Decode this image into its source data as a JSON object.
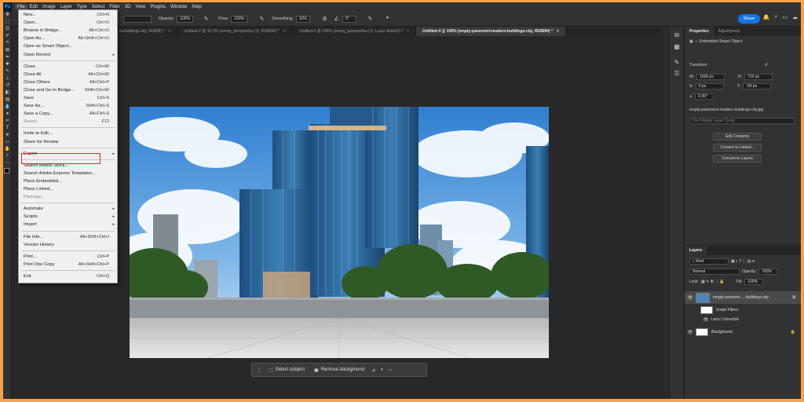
{
  "menubar": {
    "logo": "Ps",
    "items": [
      "File",
      "Edit",
      "Image",
      "Layer",
      "Type",
      "Select",
      "Filter",
      "3D",
      "View",
      "Plugins",
      "Window",
      "Help"
    ]
  },
  "options": {
    "opacity_label": "Opacity:",
    "opacity_value": "100%",
    "flow_label": "Flow:",
    "flow_value": "100%",
    "smoothing_label": "Smoothing:",
    "smoothing_value": "10%",
    "angle_value": "0°",
    "share_label": "Share"
  },
  "tabs": [
    {
      "label": "re-buildings-city, RGB/8) *",
      "active": false
    },
    {
      "label": "Untitled-2 @ 10.1% (wrong_perspective (1), RGB/8#) *",
      "active": false
    },
    {
      "label": "Untitled-3 @ 100% (wrong_perspective (1), Layer Mask/8) *",
      "active": false
    },
    {
      "label": "Untitled-4 @ 100% (empty-pavement-modern-buildings-city, RGB/8#) *",
      "active": true
    }
  ],
  "file_menu": {
    "items": [
      {
        "label": "New...",
        "shortcut": "Ctrl+N"
      },
      {
        "label": "Open...",
        "shortcut": "Ctrl+O"
      },
      {
        "label": "Browse in Bridge...",
        "shortcut": "Alt+Ctrl+O"
      },
      {
        "label": "Open As...",
        "shortcut": "Alt+Shift+Ctrl+O"
      },
      {
        "label": "Open as Smart Object...",
        "shortcut": ""
      },
      {
        "label": "Open Recent",
        "shortcut": "",
        "submenu": true
      },
      {
        "label": "Close",
        "shortcut": "Ctrl+W"
      },
      {
        "label": "Close All",
        "shortcut": "Alt+Ctrl+W"
      },
      {
        "label": "Close Others",
        "shortcut": "Alt+Ctrl+P"
      },
      {
        "label": "Close and Go to Bridge...",
        "shortcut": "Shift+Ctrl+W"
      },
      {
        "label": "Save",
        "shortcut": "Ctrl+S"
      },
      {
        "label": "Save As...",
        "shortcut": "Shift+Ctrl+S"
      },
      {
        "label": "Save a Copy...",
        "shortcut": "Alt+Ctrl+S"
      },
      {
        "label": "Revert",
        "shortcut": "F12",
        "disabled": true
      },
      {
        "label": "Invite to Edit...",
        "shortcut": ""
      },
      {
        "label": "Share for Review",
        "shortcut": ""
      },
      {
        "label": "Export",
        "shortcut": "",
        "submenu": true
      },
      {
        "label": "Search Adobe Stock...",
        "shortcut": ""
      },
      {
        "label": "Search Adobe Express Templates...",
        "shortcut": ""
      },
      {
        "label": "Place Embedded...",
        "shortcut": ""
      },
      {
        "label": "Place Linked...",
        "shortcut": ""
      },
      {
        "label": "Package...",
        "shortcut": "",
        "disabled": true
      },
      {
        "label": "Automate",
        "shortcut": "",
        "submenu": true
      },
      {
        "label": "Scripts",
        "shortcut": "",
        "submenu": true
      },
      {
        "label": "Import",
        "shortcut": "",
        "submenu": true
      },
      {
        "label": "File Info...",
        "shortcut": "Alt+Shift+Ctrl+I"
      },
      {
        "label": "Version History",
        "shortcut": ""
      },
      {
        "label": "Print...",
        "shortcut": "Ctrl+P"
      },
      {
        "label": "Print One Copy",
        "shortcut": "Alt+Shift+Ctrl+P"
      },
      {
        "label": "Exit",
        "shortcut": "Ctrl+Q"
      }
    ]
  },
  "floatbar": {
    "select_subject": "Select subject",
    "remove_background": "Remove background"
  },
  "properties": {
    "tab_properties": "Properties",
    "tab_adjustments": "Adjustments",
    "object_type": "Embedded Smart Object",
    "transform_label": "Transform",
    "w_label": "W:",
    "w_value": "1000 px",
    "h_label": "H:",
    "h_value": "710 px",
    "x_label": "X:",
    "x_value": "0 px",
    "y_label": "Y:",
    "y_value": "-59 px",
    "angle_value": "0.00°",
    "file_name": "empty-pavement-modern-buildings-city.jpg",
    "layer_comp_placeholder": "Don't Apply Layer Comp",
    "edit_contents": "Edit Contents",
    "convert_linked": "Convert to Linked...",
    "convert_layers": "Convert to Layers"
  },
  "layers": {
    "tab_label": "Layers",
    "kind_label": "Kind",
    "blend_mode": "Normal",
    "opacity_label": "Opacity:",
    "opacity_value": "100%",
    "lock_label": "Lock:",
    "fill_label": "Fill:",
    "fill_value": "100%",
    "items": [
      {
        "name": "empty-pavemnt-...-buildings-city"
      },
      {
        "name": "Smart Filters"
      },
      {
        "name": "Lens Correction"
      },
      {
        "name": "Background"
      }
    ]
  },
  "colors": {
    "accent": "#1473e6",
    "highlight_border": "#e0262b",
    "frame": "#f5a24b"
  }
}
